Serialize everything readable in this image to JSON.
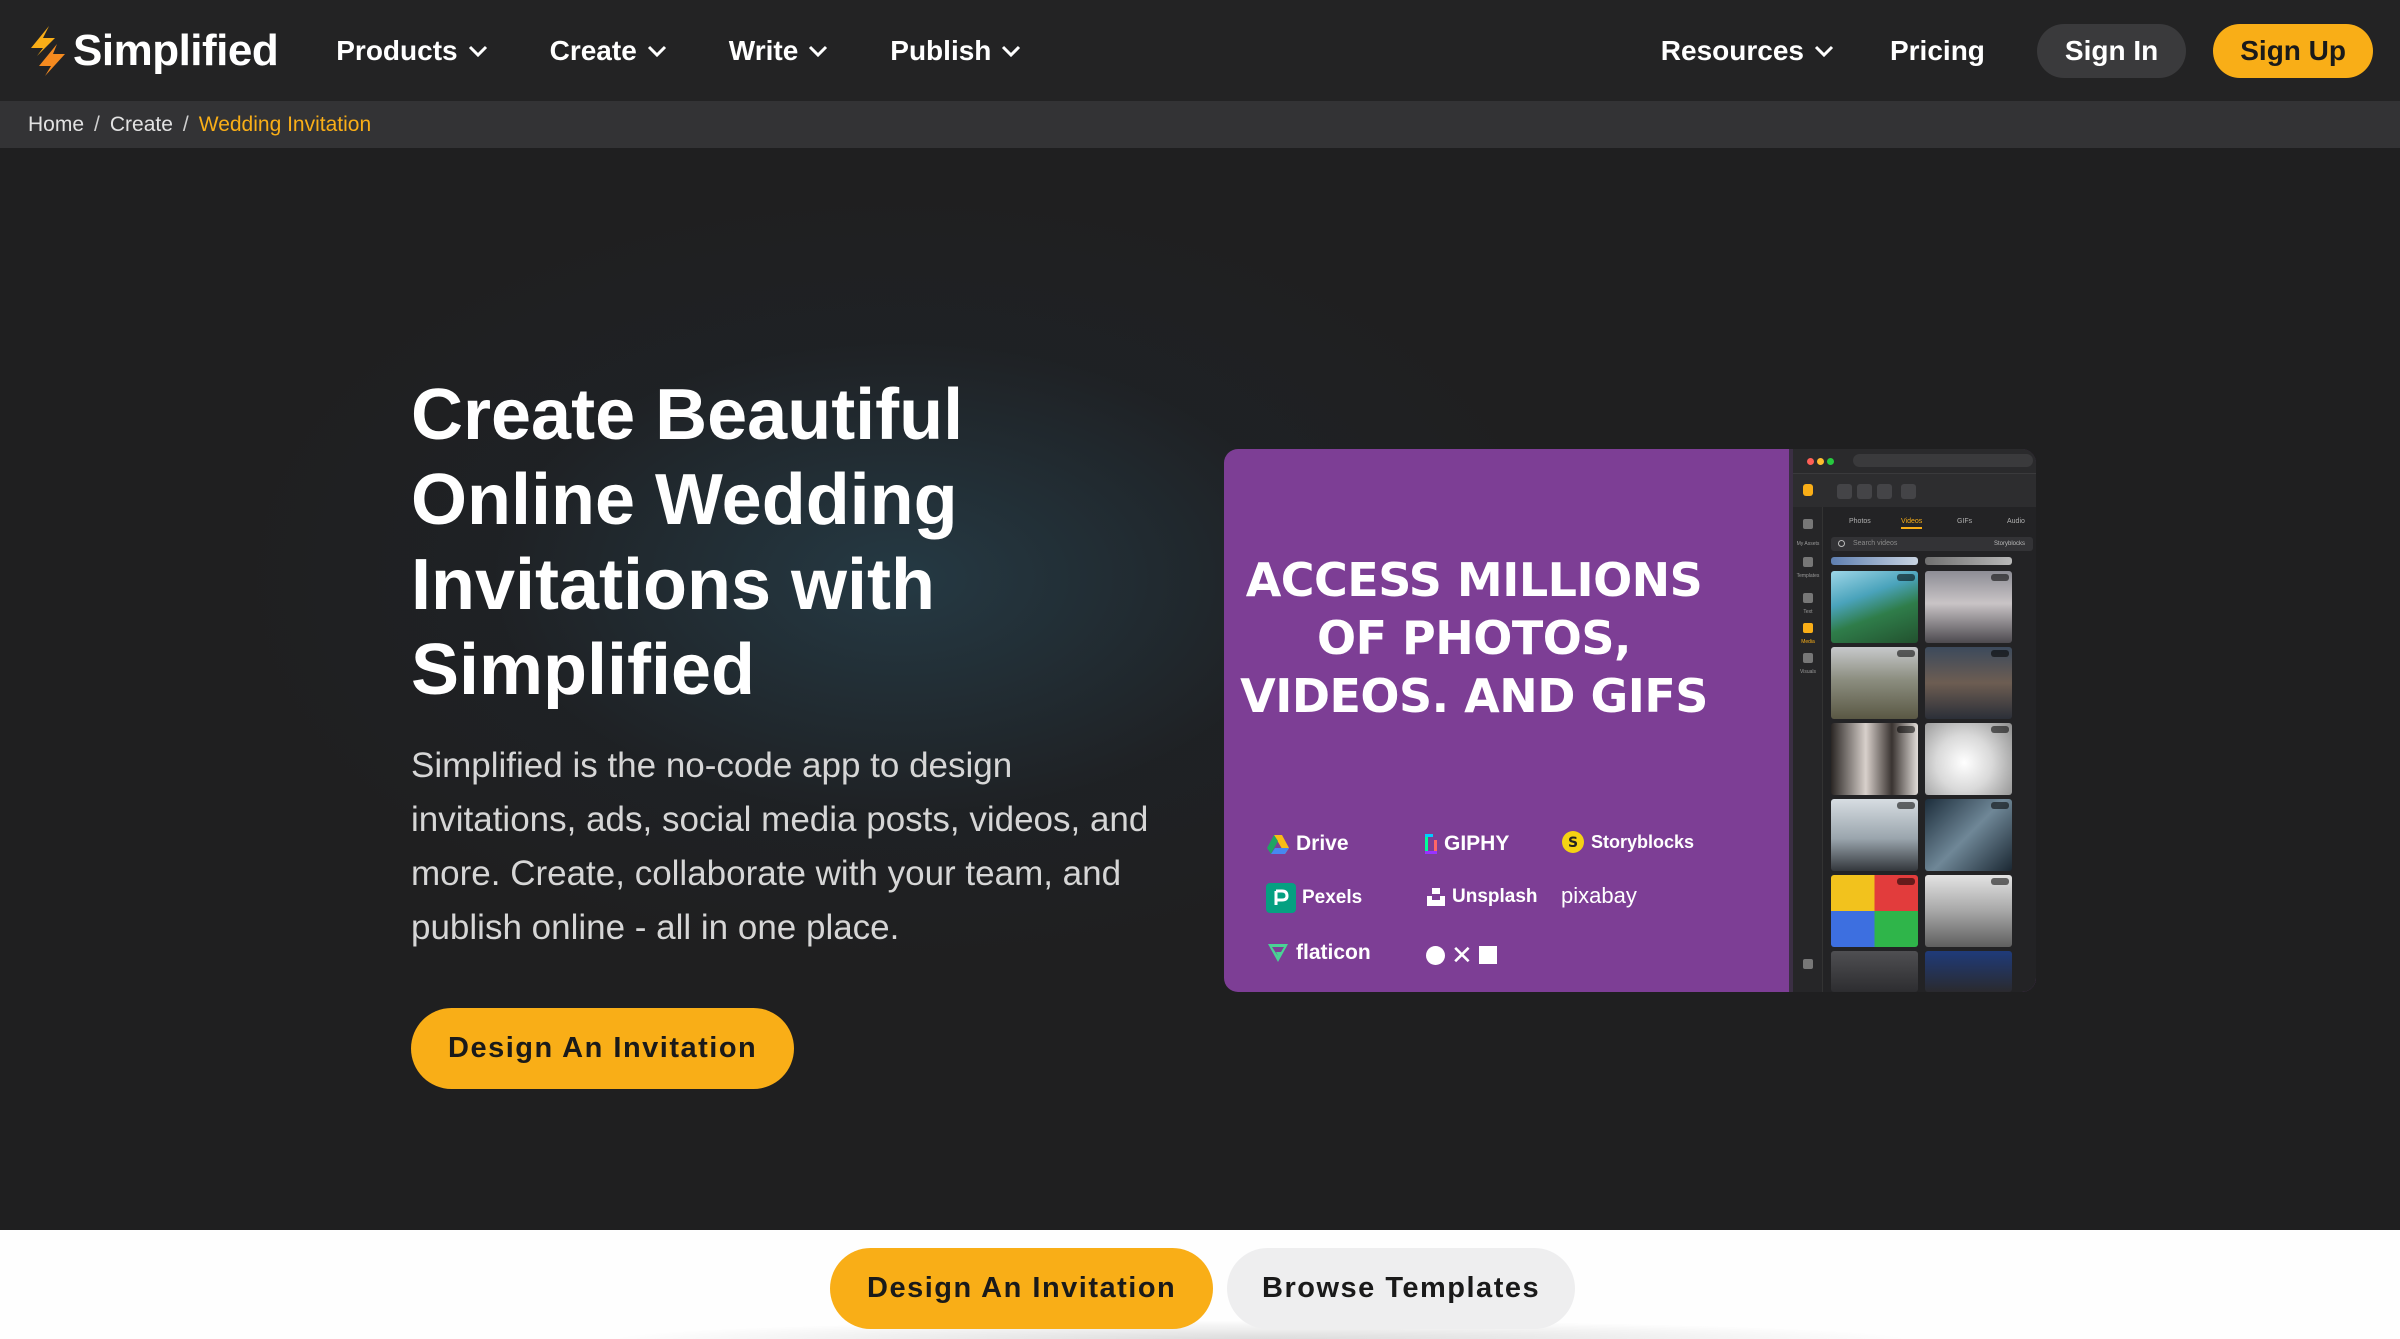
{
  "brand": {
    "name": "Simplified",
    "accent": "#f9ae17"
  },
  "nav": {
    "products": "Products",
    "create": "Create",
    "write": "Write",
    "publish": "Publish",
    "resources": "Resources",
    "pricing": "Pricing",
    "sign_in": "Sign In",
    "sign_up": "Sign Up"
  },
  "breadcrumb": {
    "items": [
      "Home",
      "Create",
      "Wedding Invitation"
    ],
    "separator": "/"
  },
  "hero": {
    "title": "Create Beautiful Online Wedding Invitations with Simplified",
    "description": "Simplified is the no-code app to design invitations, ads, social media posts, videos, and more. Create, collaborate with your team, and publish online - all in one place.",
    "cta": "Design An Invitation"
  },
  "promo": {
    "headline": "ACCESS MILLIONS OF PHOTOS, VIDEOS. AND GIFS",
    "providers": [
      "Drive",
      "GIPHY",
      "Storyblocks",
      "Pexels",
      "Unsplash",
      "pixabay",
      "flaticon"
    ],
    "app": {
      "tabs": [
        "Photos",
        "Videos",
        "GIFs",
        "Audio"
      ],
      "active_tab": "Videos",
      "search_placeholder": "Search videos",
      "search_source": "Storyblocks",
      "rail_labels": [
        "My Assets",
        "Templates",
        "Text",
        "Media",
        "Visuals"
      ]
    }
  },
  "bottom_bar": {
    "primary": "Design An Invitation",
    "secondary": "Browse Templates"
  }
}
